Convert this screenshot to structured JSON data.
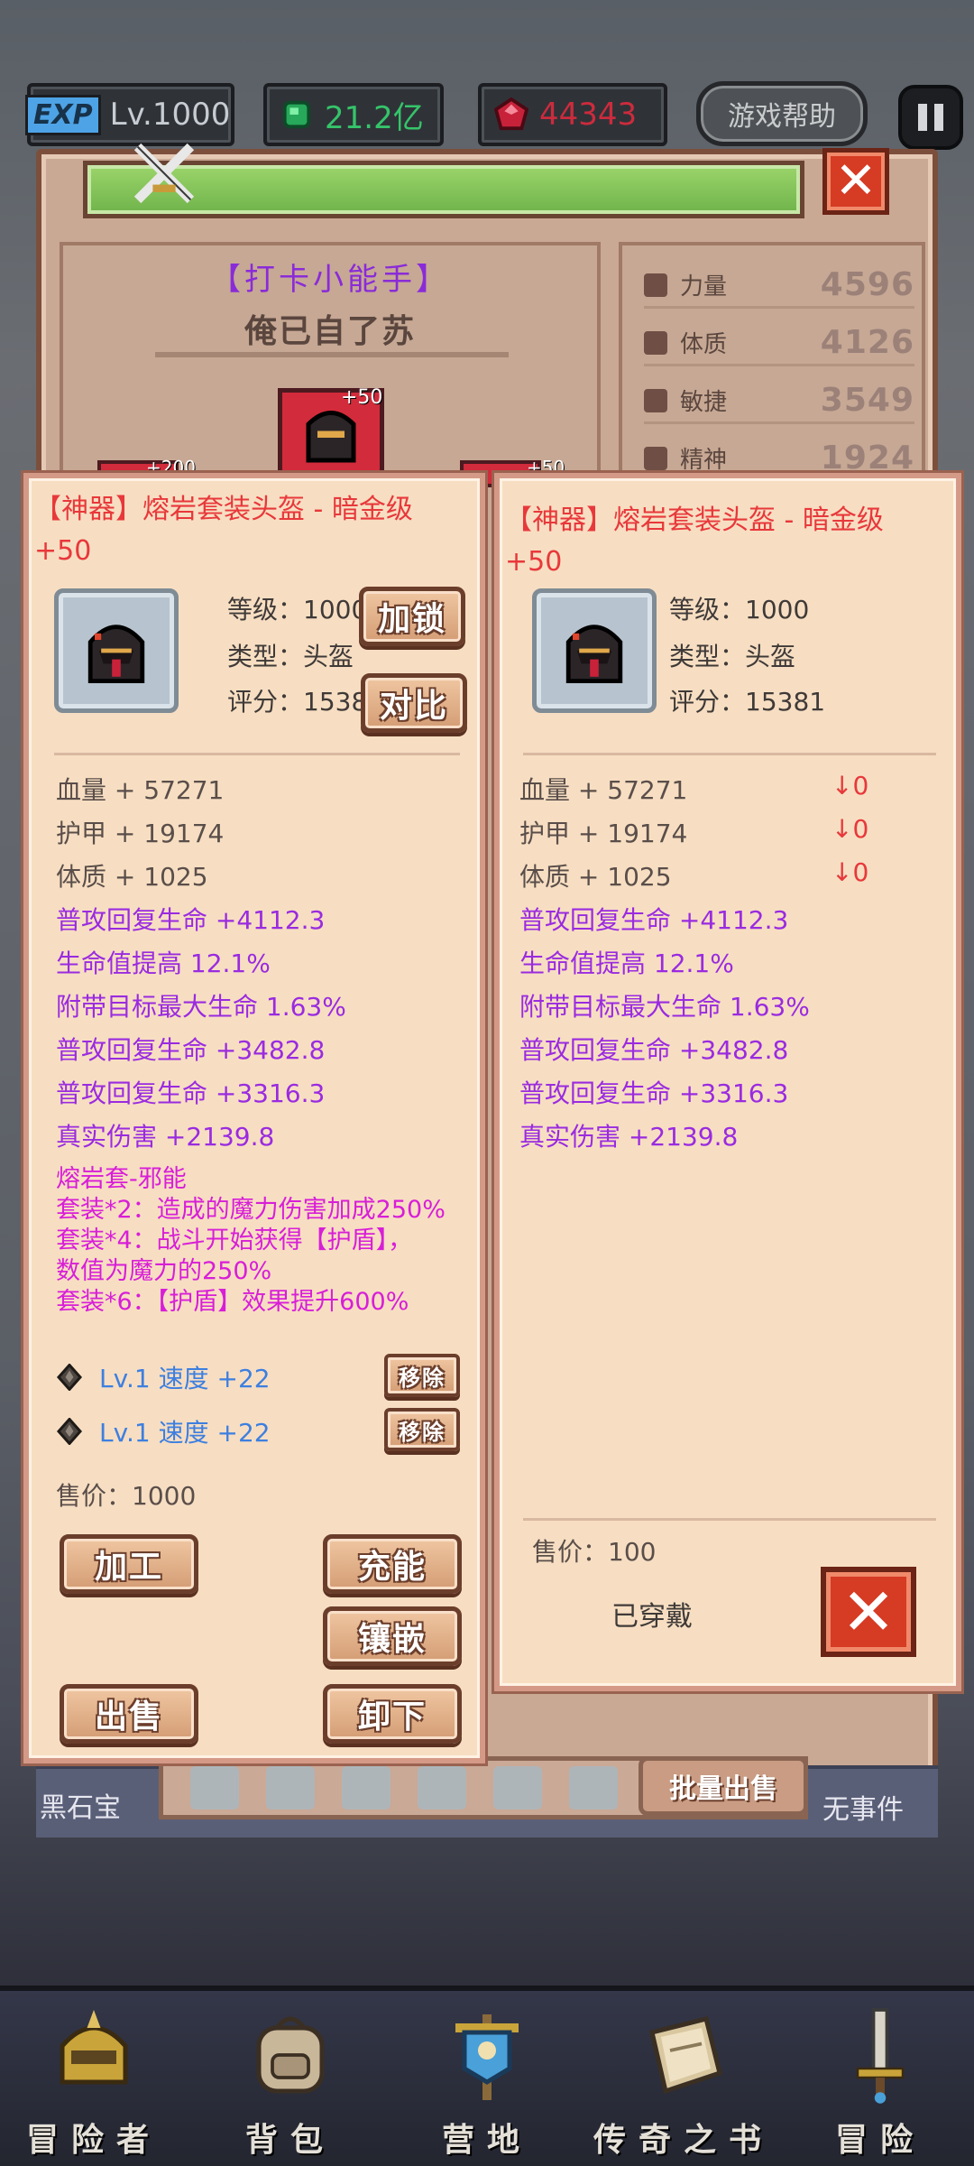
{
  "hud": {
    "exp_tag": "EXP",
    "level": "Lv.1000",
    "green_currency": "21.2亿",
    "red_currency": "44343",
    "help_label": "游戏帮助"
  },
  "character": {
    "title": "【打卡小能手】",
    "name": "俺已自了苏",
    "slot_plus": "+50",
    "side_plus_left": "+200",
    "side_plus_right": "+50",
    "stats": [
      {
        "label": "力量",
        "value": "4596"
      },
      {
        "label": "体质",
        "value": "4126"
      },
      {
        "label": "敏捷",
        "value": "3549"
      },
      {
        "label": "精神",
        "value": "1924"
      }
    ]
  },
  "left_item": {
    "title_line1": "【神器】熔岩套装头盔 - 暗金级",
    "title_line2": "+50",
    "level": "等级：1000",
    "type": "类型：头盔",
    "score": "评分：15381",
    "lock_label": "加锁",
    "compare_label": "对比",
    "base_attrs": [
      "血量 + 57271",
      "护甲 + 19174",
      "体质 + 1025"
    ],
    "extra_attrs": [
      "普攻回复生命 +4112.3",
      "生命值提高 12.1%",
      "附带目标最大生命 1.63%",
      "普攻回复生命 +3482.8",
      "普攻回复生命 +3316.3",
      "真实伤害 +2139.8"
    ],
    "set_lines": [
      "熔岩套-邪能",
      "套装*2：造成的魔力伤害加成250%",
      "套装*4：战斗开始获得【护盾】，",
      "数值为魔力的250%",
      "套装*6：【护盾】效果提升600%"
    ],
    "gems": [
      {
        "text": "Lv.1 速度 +22",
        "remove_label": "移除"
      },
      {
        "text": "Lv.1 速度 +22",
        "remove_label": "移除"
      }
    ],
    "price": "售价：1000",
    "buttons": {
      "process": "加工",
      "charge": "充能",
      "inlay": "镶嵌",
      "sell": "出售",
      "unequip": "卸下"
    }
  },
  "right_item": {
    "title_line1": "【神器】熔岩套装头盔 - 暗金级",
    "title_line2": "+50",
    "level": "等级：1000",
    "type": "类型：头盔",
    "score": "评分：15381",
    "base_attrs": [
      "血量 + 57271",
      "护甲 + 19174",
      "体质 + 1025"
    ],
    "diffs": [
      "↓0",
      "↓0",
      "↓0"
    ],
    "extra_attrs": [
      "普攻回复生命 +4112.3",
      "生命值提高 12.1%",
      "附带目标最大生命 1.63%",
      "普攻回复生命 +3482.8",
      "普攻回复生命 +3316.3",
      "真实伤害 +2139.8"
    ],
    "price": "售价：100",
    "equipped_label": "已穿戴"
  },
  "strip": {
    "left_text": "黑石宝",
    "right_text": "无事件",
    "batch_sell": "批量出售"
  },
  "nav": [
    {
      "label": "冒险者",
      "icon": "adventurer-helmet-icon"
    },
    {
      "label": "背包",
      "icon": "backpack-icon"
    },
    {
      "label": "营地",
      "icon": "camp-banner-icon"
    },
    {
      "label": "传奇之书",
      "icon": "legend-book-icon"
    },
    {
      "label": "冒险",
      "icon": "sword-icon"
    }
  ],
  "colors": {
    "title_red": "#e8383b",
    "attr_purple": "#9a2be0",
    "set_magenta": "#d81ed8",
    "gem_blue": "#3d7fe0",
    "popup_bg": "#f7dec2"
  }
}
